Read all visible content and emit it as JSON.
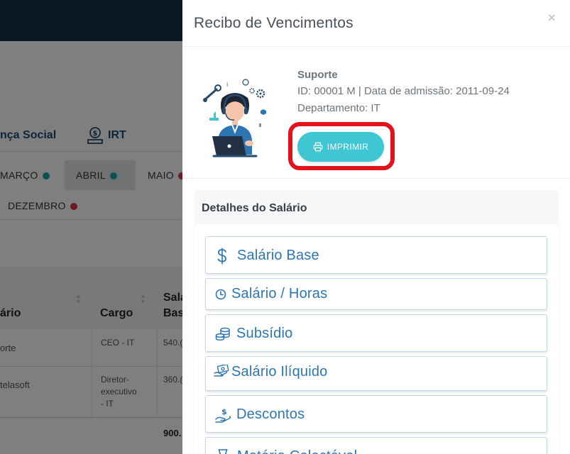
{
  "background": {
    "tabs": [
      {
        "label": "nça Social"
      },
      {
        "label": "IRT"
      }
    ],
    "months": [
      {
        "label": "MARÇO",
        "status_color": "#1aa3a9"
      },
      {
        "label": "ABRIL",
        "status_color": "#1aa3a9"
      },
      {
        "label": "MAIO",
        "status_color": "#dc3545"
      },
      {
        "label": "DEZEMBRO",
        "status_color": "#dc3545"
      }
    ],
    "table": {
      "headers": [
        "ário",
        "Cargo",
        "Sala",
        "Bas"
      ],
      "rows": [
        {
          "name": "orte",
          "cargo": "CEO - IT",
          "salario": "540.("
        },
        {
          "name": "telasoft",
          "cargo_lines": [
            "Diretor-",
            "executivo",
            "- IT"
          ],
          "salario": "360.("
        }
      ],
      "total": "900."
    }
  },
  "modal": {
    "title": "Recibo de Vencimentos",
    "close_label": "×",
    "employee": {
      "name": "Suporte",
      "id_line": "ID: 00001 M | Data de admissão: 2011-09-24",
      "department_line": "Departamento: IT"
    },
    "print_button": {
      "label": "IMPRIMIR",
      "icon": "printer-icon"
    },
    "details": {
      "title": "Detalhes do Salário",
      "items": [
        {
          "label": "Salário Base",
          "icon": "dollar-icon"
        },
        {
          "label": "Salário / Horas",
          "icon": "clock-icon"
        },
        {
          "label": "Subsídio",
          "icon": "coins-icon"
        },
        {
          "label": "Salário Ilíquido",
          "icon": "money-hand-icon"
        },
        {
          "label": "Descontos",
          "icon": "hand-dollar-icon"
        },
        {
          "label": "Matéria Colectável",
          "icon": "hourglass-icon"
        }
      ]
    }
  },
  "colors": {
    "topbar": "#123147",
    "accent_cyan": "#3ec6d3",
    "highlight_red": "#e3131c",
    "link_blue": "#2e76b3",
    "bg_tab_blue": "#1b4b76"
  }
}
